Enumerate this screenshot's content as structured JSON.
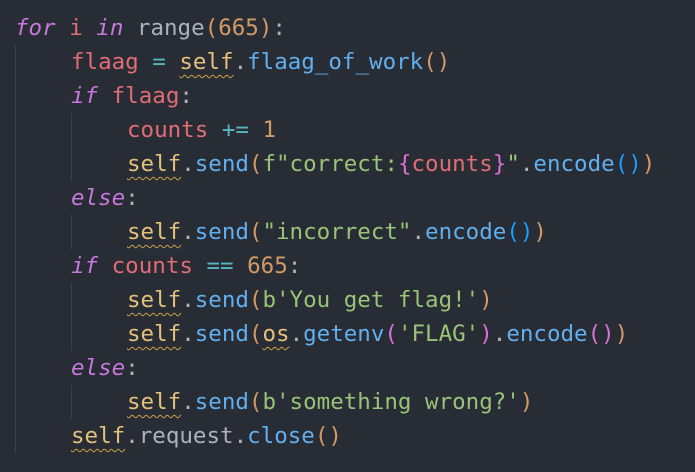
{
  "code": {
    "language": "python",
    "lines": [
      {
        "indent": 0,
        "tokens": [
          {
            "text": "for",
            "type": "kw"
          },
          {
            "text": " ",
            "type": "pun"
          },
          {
            "text": "i",
            "type": "var"
          },
          {
            "text": " ",
            "type": "pun"
          },
          {
            "text": "in",
            "type": "kw"
          },
          {
            "text": " ",
            "type": "pun"
          },
          {
            "text": "range",
            "type": "pun"
          },
          {
            "text": "(",
            "type": "brk"
          },
          {
            "text": "665",
            "type": "num"
          },
          {
            "text": ")",
            "type": "brk"
          },
          {
            "text": ":",
            "type": "pun"
          }
        ]
      },
      {
        "indent": 1,
        "tokens": [
          {
            "text": "flaag",
            "type": "var"
          },
          {
            "text": " ",
            "type": "pun"
          },
          {
            "text": "=",
            "type": "op"
          },
          {
            "text": " ",
            "type": "pun"
          },
          {
            "text": "self",
            "type": "self"
          },
          {
            "text": ".",
            "type": "pun"
          },
          {
            "text": "flaag_of_work",
            "type": "fn"
          },
          {
            "text": "()",
            "type": "brk"
          }
        ]
      },
      {
        "indent": 1,
        "tokens": [
          {
            "text": "if",
            "type": "kw"
          },
          {
            "text": " ",
            "type": "pun"
          },
          {
            "text": "flaag",
            "type": "var"
          },
          {
            "text": ":",
            "type": "pun"
          }
        ]
      },
      {
        "indent": 2,
        "tokens": [
          {
            "text": "counts",
            "type": "var"
          },
          {
            "text": " ",
            "type": "pun"
          },
          {
            "text": "+=",
            "type": "op"
          },
          {
            "text": " ",
            "type": "pun"
          },
          {
            "text": "1",
            "type": "num"
          }
        ]
      },
      {
        "indent": 2,
        "tokens": [
          {
            "text": "self",
            "type": "self"
          },
          {
            "text": ".",
            "type": "pun"
          },
          {
            "text": "send",
            "type": "fn"
          },
          {
            "text": "(",
            "type": "brk"
          },
          {
            "text": "f\"correct:",
            "type": "str"
          },
          {
            "text": "{",
            "type": "brk2"
          },
          {
            "text": "counts",
            "type": "var"
          },
          {
            "text": "}",
            "type": "brk2"
          },
          {
            "text": "\"",
            "type": "str"
          },
          {
            "text": ".",
            "type": "pun"
          },
          {
            "text": "encode",
            "type": "fn"
          },
          {
            "text": "()",
            "type": "brk3"
          },
          {
            "text": ")",
            "type": "brk"
          }
        ]
      },
      {
        "indent": 1,
        "tokens": [
          {
            "text": "else",
            "type": "kw"
          },
          {
            "text": ":",
            "type": "pun"
          }
        ]
      },
      {
        "indent": 2,
        "tokens": [
          {
            "text": "self",
            "type": "self"
          },
          {
            "text": ".",
            "type": "pun"
          },
          {
            "text": "send",
            "type": "fn"
          },
          {
            "text": "(",
            "type": "brk"
          },
          {
            "text": "\"incorrect\"",
            "type": "str"
          },
          {
            "text": ".",
            "type": "pun"
          },
          {
            "text": "encode",
            "type": "fn"
          },
          {
            "text": "()",
            "type": "brk3"
          },
          {
            "text": ")",
            "type": "brk"
          }
        ]
      },
      {
        "indent": 1,
        "tokens": [
          {
            "text": "if",
            "type": "kw"
          },
          {
            "text": " ",
            "type": "pun"
          },
          {
            "text": "counts",
            "type": "var"
          },
          {
            "text": " ",
            "type": "pun"
          },
          {
            "text": "==",
            "type": "op"
          },
          {
            "text": " ",
            "type": "pun"
          },
          {
            "text": "665",
            "type": "num"
          },
          {
            "text": ":",
            "type": "pun"
          }
        ]
      },
      {
        "indent": 2,
        "tokens": [
          {
            "text": "self",
            "type": "self"
          },
          {
            "text": ".",
            "type": "pun"
          },
          {
            "text": "send",
            "type": "fn"
          },
          {
            "text": "(",
            "type": "brk"
          },
          {
            "text": "b'You get flag!'",
            "type": "str"
          },
          {
            "text": ")",
            "type": "brk"
          }
        ]
      },
      {
        "indent": 2,
        "tokens": [
          {
            "text": "self",
            "type": "self"
          },
          {
            "text": ".",
            "type": "pun"
          },
          {
            "text": "send",
            "type": "fn"
          },
          {
            "text": "(",
            "type": "brk"
          },
          {
            "text": "os",
            "type": "self"
          },
          {
            "text": ".",
            "type": "pun"
          },
          {
            "text": "getenv",
            "type": "fn"
          },
          {
            "text": "(",
            "type": "brk2"
          },
          {
            "text": "'FLAG'",
            "type": "str"
          },
          {
            "text": ")",
            "type": "brk2"
          },
          {
            "text": ".",
            "type": "pun"
          },
          {
            "text": "encode",
            "type": "fn"
          },
          {
            "text": "()",
            "type": "brk2"
          },
          {
            "text": ")",
            "type": "brk"
          }
        ]
      },
      {
        "indent": 1,
        "tokens": [
          {
            "text": "else",
            "type": "kw"
          },
          {
            "text": ":",
            "type": "pun"
          }
        ]
      },
      {
        "indent": 2,
        "tokens": [
          {
            "text": "self",
            "type": "self"
          },
          {
            "text": ".",
            "type": "pun"
          },
          {
            "text": "send",
            "type": "fn"
          },
          {
            "text": "(",
            "type": "brk"
          },
          {
            "text": "b'something wrong?'",
            "type": "str"
          },
          {
            "text": ")",
            "type": "brk"
          }
        ]
      },
      {
        "indent": 1,
        "tokens": [
          {
            "text": "self",
            "type": "self"
          },
          {
            "text": ".",
            "type": "pun"
          },
          {
            "text": "request",
            "type": "pun"
          },
          {
            "text": ".",
            "type": "pun"
          },
          {
            "text": "close",
            "type": "fn"
          },
          {
            "text": "()",
            "type": "brk"
          }
        ]
      }
    ]
  },
  "colors": {
    "background": "#282c34",
    "keyword": "#c678dd",
    "variable": "#e06c75",
    "function": "#61afef",
    "number": "#d19a66",
    "string": "#98c379",
    "operator": "#56b6c2",
    "self": "#e5c07b"
  }
}
